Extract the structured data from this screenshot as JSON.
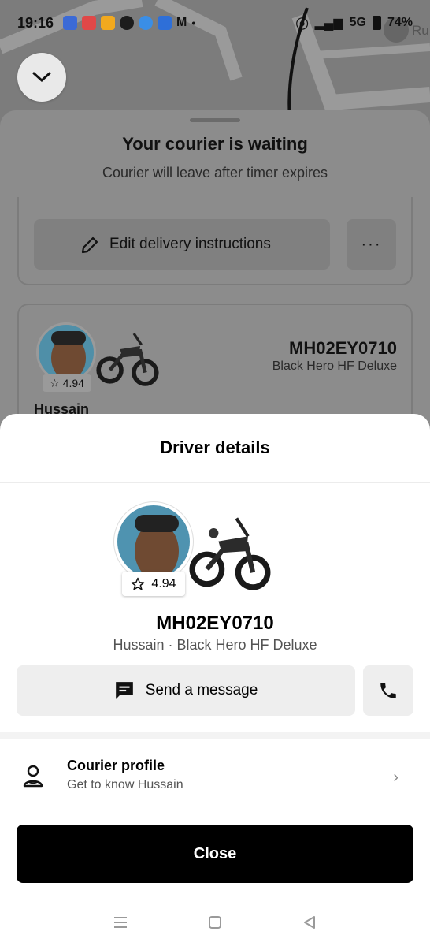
{
  "status_bar": {
    "time": "19:16",
    "right": "74%",
    "network": "5G"
  },
  "map": {
    "label": "Ru"
  },
  "back_sheet": {
    "title": "Your courier is waiting",
    "subtitle": "Courier will leave after timer expires",
    "edit_label": "Edit delivery instructions",
    "more_label": "···",
    "plate": "MH02EY0710",
    "vehicle": "Black Hero HF Deluxe",
    "rating": "4.94",
    "driver_name": "Hussain"
  },
  "modal": {
    "title": "Driver details",
    "rating": "4.94",
    "plate": "MH02EY0710",
    "sub_line": "Hussain · Black Hero HF Deluxe",
    "message_label": "Send a message",
    "profile_title": "Courier profile",
    "profile_sub": "Get to know Hussain",
    "close_label": "Close"
  },
  "colors": {
    "primary": "#000000",
    "button_bg": "#eeeeee",
    "avatar_bg": "#4f93b0"
  },
  "icons": {
    "collapse": "chevron-down-icon",
    "edit": "pencil-icon",
    "rating": "star-icon",
    "message": "message-icon",
    "call": "phone-icon",
    "profile": "person-icon",
    "nav": [
      "menu-icon",
      "home-icon",
      "back-icon"
    ]
  }
}
